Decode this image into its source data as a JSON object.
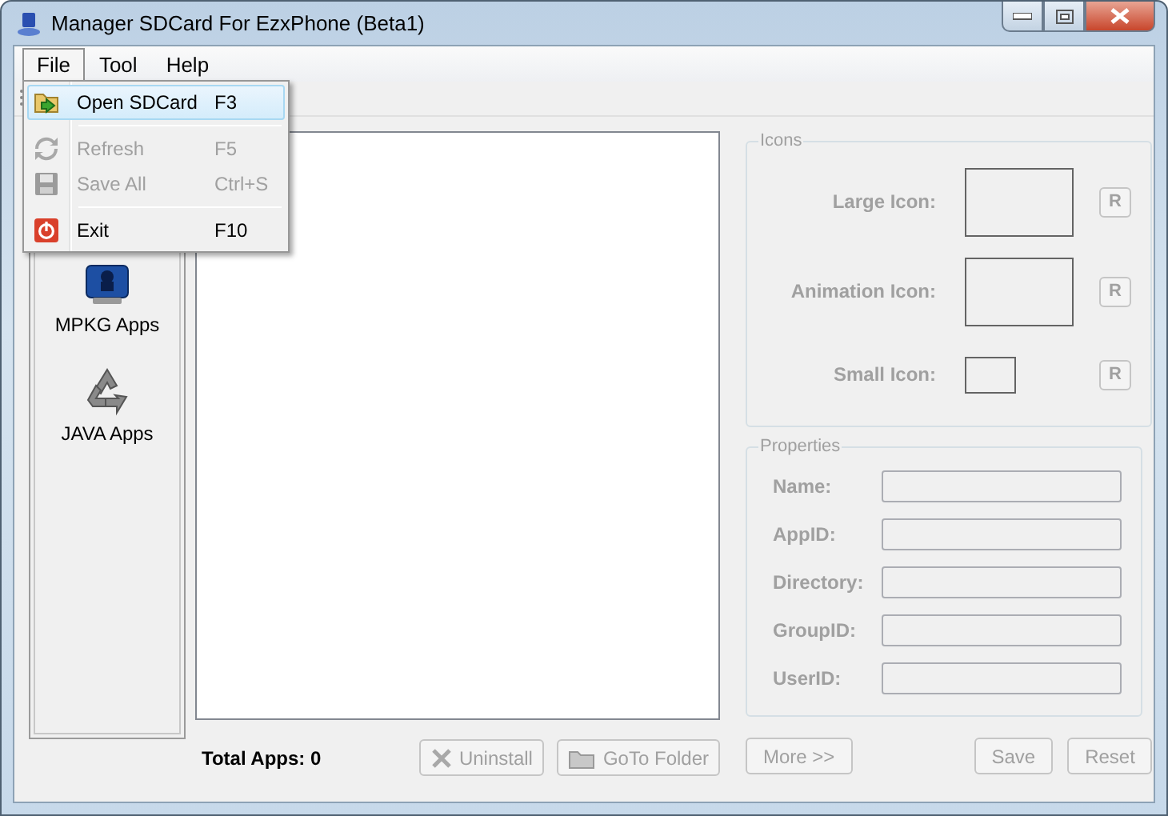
{
  "window": {
    "title": "Manager SDCard For EzxPhone (Beta1)"
  },
  "menu": [
    {
      "label": "File",
      "selected": true
    },
    {
      "label": "Tool",
      "selected": false
    },
    {
      "label": "Help",
      "selected": false
    }
  ],
  "dropdown": [
    {
      "kind": "item",
      "label": "Open SDCard",
      "shortcut": "F3",
      "selected": true,
      "disabled": false
    },
    {
      "kind": "separator"
    },
    {
      "kind": "item",
      "label": "Refresh",
      "shortcut": "F5",
      "selected": false,
      "disabled": true
    },
    {
      "kind": "item",
      "label": "Save All",
      "shortcut": "Ctrl+S",
      "selected": false,
      "disabled": true
    },
    {
      "kind": "separator"
    },
    {
      "kind": "item",
      "label": "Exit",
      "shortcut": "F10",
      "selected": false,
      "disabled": false
    }
  ],
  "sidebar": {
    "items": [
      {
        "label": "MPKG Apps"
      },
      {
        "label": "JAVA Apps"
      }
    ]
  },
  "total_apps": "Total Apps: 0",
  "list_buttons": [
    {
      "label": "Uninstall",
      "disabled": true
    },
    {
      "label": "GoTo Folder",
      "disabled": true
    }
  ],
  "icons_group": {
    "title": "Icons",
    "rows": [
      {
        "kind": "large",
        "label": "Large Icon:",
        "button": "R"
      },
      {
        "kind": "large",
        "label": "Animation Icon:",
        "button": "R"
      },
      {
        "kind": "small",
        "label": "Small Icon:",
        "button": "R"
      }
    ]
  },
  "properties": {
    "title": "Properties",
    "fields": [
      {
        "label": "Name:",
        "disabled": true
      },
      {
        "label": "AppID:",
        "disabled": true
      },
      {
        "label": "Directory:",
        "disabled": true
      },
      {
        "label": "GroupID:",
        "disabled": true
      },
      {
        "label": "UserID:",
        "disabled": true
      }
    ]
  },
  "bottom_buttons": [
    {
      "label": "More >>",
      "disabled": true
    },
    {
      "label": "Save",
      "disabled": true
    },
    {
      "label": "Reset",
      "disabled": true
    }
  ]
}
